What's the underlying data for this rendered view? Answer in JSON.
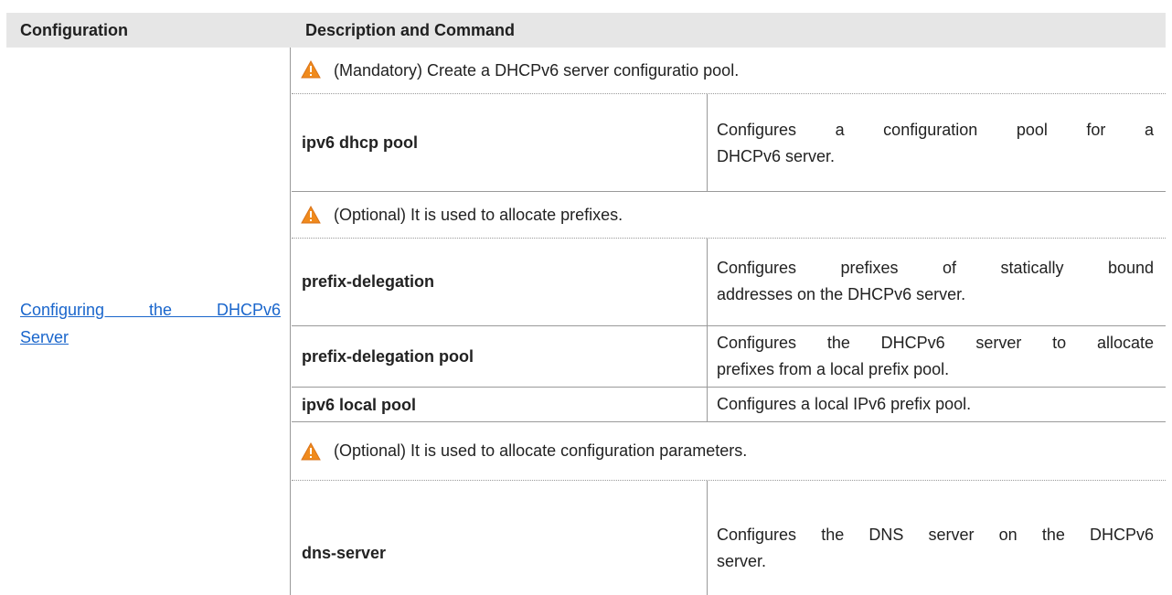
{
  "header": {
    "col1": "Configuration",
    "col2": "Description and Command"
  },
  "config_link": {
    "line1": "Configuring the DHCPv6",
    "line2": "Server"
  },
  "rows": [
    {
      "type": "warning",
      "icon": "warning-triangle-icon",
      "text": "(Mandatory) Create a DHCPv6 server configuratio pool."
    },
    {
      "type": "command",
      "command": "ipv6 dhcp pool",
      "desc_line1": "Configures a configuration pool for a",
      "desc_line2": "DHCPv6 server."
    },
    {
      "type": "warning",
      "icon": "warning-triangle-icon",
      "text": "(Optional) It is used to allocate prefixes."
    },
    {
      "type": "command",
      "command": "prefix-delegation",
      "desc_line1": "Configures prefixes of statically bound",
      "desc_line2": "addresses on the DHCPv6 server."
    },
    {
      "type": "command",
      "command": "prefix-delegation pool",
      "desc_line1": "Configures the DHCPv6 server to allocate",
      "desc_line2": "prefixes from a local prefix pool."
    },
    {
      "type": "command",
      "command": "ipv6 local pool",
      "desc_line1": "Configures a local IPv6 prefix pool."
    },
    {
      "type": "warning",
      "icon": "warning-triangle-icon",
      "text": "(Optional) It is used to allocate configuration parameters."
    },
    {
      "type": "command",
      "command": "dns-server",
      "desc_line1": "Configures the DNS server on the DHCPv6",
      "desc_line2": "server."
    }
  ],
  "colors": {
    "header_bg": "#e6e6e6",
    "link": "#1a66cc",
    "warning_fill": "#f08a1c",
    "border": "#9a9a9a"
  }
}
